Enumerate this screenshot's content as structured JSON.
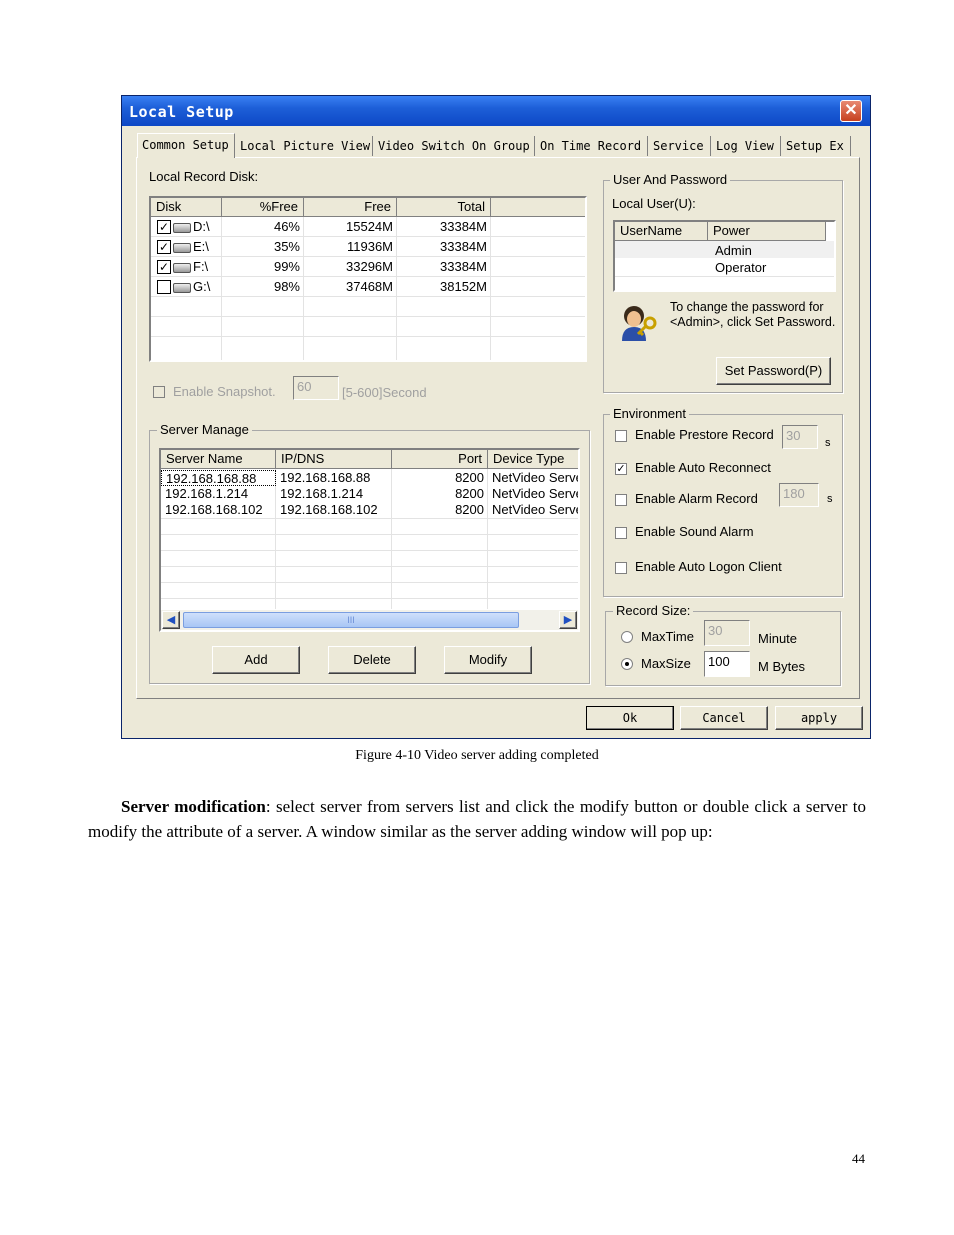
{
  "window": {
    "title": "Local Setup",
    "close_glyph": "✕",
    "tabs": [
      "Common Setup",
      "Local Picture View",
      "Video Switch On Group",
      "On Time Record",
      "Service",
      "Log View",
      "Setup Ex"
    ],
    "active_tab": "Common Setup"
  },
  "disk": {
    "label": "Local Record Disk:",
    "columns": [
      "Disk",
      "%Free",
      "Free",
      "Total"
    ],
    "rows": [
      {
        "checked": true,
        "disk": "D:\\",
        "pct": "46%",
        "free": "15524M",
        "total": "33384M"
      },
      {
        "checked": true,
        "disk": "E:\\",
        "pct": "35%",
        "free": "11936M",
        "total": "33384M"
      },
      {
        "checked": true,
        "disk": "F:\\",
        "pct": "99%",
        "free": "33296M",
        "total": "33384M"
      },
      {
        "checked": false,
        "disk": "G:\\",
        "pct": "98%",
        "free": "37468M",
        "total": "38152M"
      }
    ]
  },
  "snapshot": {
    "label": "Enable Snapshot.",
    "value": "60",
    "range": "[5-600]Second"
  },
  "server_manage": {
    "title": "Server Manage",
    "columns": [
      "Server Name",
      "IP/DNS",
      "Port",
      "Device Type"
    ],
    "rows": [
      {
        "name": "192.168.168.88",
        "ip": "192.168.168.88",
        "port": "8200",
        "type": "NetVideo Serve"
      },
      {
        "name": "192.168.1.214",
        "ip": "192.168.1.214",
        "port": "8200",
        "type": "NetVideo Serve"
      },
      {
        "name": "192.168.168.102",
        "ip": "192.168.168.102",
        "port": "8200",
        "type": "NetVideo Serve"
      }
    ],
    "scroll_thumb": "III",
    "buttons": {
      "add": "Add",
      "delete": "Delete",
      "modify": "Modify"
    }
  },
  "user": {
    "title": "User And Password",
    "local_user_label": "Local User(U):",
    "columns": [
      "UserName",
      "Power"
    ],
    "rows": [
      {
        "name": "",
        "power": "Admin"
      },
      {
        "name": "",
        "power": "Operator"
      }
    ],
    "hint": "To change the password for <Admin>, click Set Password.",
    "set_password": "Set Password(P)"
  },
  "environment": {
    "title": "Environment",
    "prestore": {
      "label": "Enable Prestore Record",
      "checked": false,
      "value": "30",
      "unit": "s"
    },
    "reconnect": {
      "label": "Enable Auto Reconnect",
      "checked": true
    },
    "alarm_record": {
      "label": "Enable Alarm Record",
      "checked": false,
      "value": "180",
      "unit": "s"
    },
    "sound_alarm": {
      "label": "Enable Sound Alarm",
      "checked": false
    },
    "auto_logon": {
      "label": "Enable Auto Logon Client",
      "checked": false
    }
  },
  "record_size": {
    "title": "Record Size:",
    "maxtime": {
      "label": "MaxTime",
      "value": "30",
      "unit": "Minute",
      "selected": false
    },
    "maxsize": {
      "label": "MaxSize",
      "value": "100",
      "unit": "M Bytes",
      "selected": true
    }
  },
  "footer_buttons": {
    "ok": "Ok",
    "cancel": "Cancel",
    "apply": "apply"
  },
  "caption": "Figure 4-10 Video server adding completed",
  "paragraph": {
    "bold": "Server modification",
    "text": ": select server from servers list and click the modify button or double click a server to modify the attribute of a server. A window similar as the server adding window will pop up:"
  },
  "page_number": "44"
}
